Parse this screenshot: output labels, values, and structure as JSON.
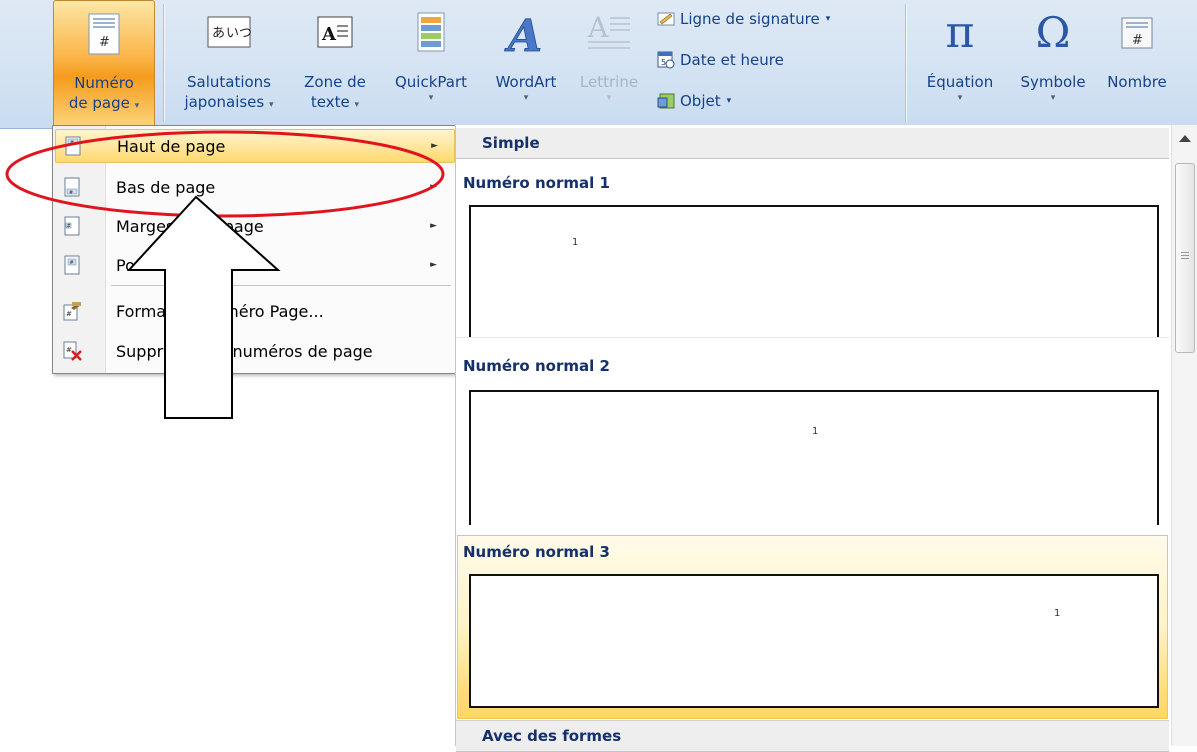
{
  "ribbon": {
    "page_number": {
      "line1": "Numéro",
      "line2": "de page",
      "caret": "▾",
      "icon": "page-number-icon"
    },
    "greetings": {
      "line1": "Salutations",
      "line2": "japonaises",
      "caret": "▾",
      "icon": "japanese-greetings-icon"
    },
    "textbox": {
      "line1": "Zone de",
      "line2": "texte",
      "caret": "▾",
      "icon": "text-box-icon"
    },
    "quickpart": {
      "line1": "QuickPart",
      "caret": "▾",
      "icon": "quickpart-icon"
    },
    "wordart": {
      "line1": "WordArt",
      "caret": "▾",
      "icon": "wordart-icon"
    },
    "dropcap": {
      "line1": "Lettrine",
      "caret": "▾",
      "icon": "dropcap-icon"
    },
    "signature_line": {
      "label": "Ligne de signature",
      "caret": "▾",
      "icon": "signature-icon"
    },
    "date_time": {
      "label": "Date et heure",
      "icon": "calendar-icon"
    },
    "object": {
      "label": "Objet",
      "caret": "▾",
      "icon": "object-icon"
    },
    "equation": {
      "line1": "Équation",
      "caret": "▾",
      "icon": "pi-icon",
      "glyph": "π"
    },
    "symbol": {
      "line1": "Symbole",
      "caret": "▾",
      "icon": "omega-icon",
      "glyph": "Ω"
    },
    "number": {
      "line1": "Nombre",
      "icon": "number-icon"
    }
  },
  "menu": {
    "items": [
      {
        "label": "Haut de page",
        "has_submenu": true,
        "highlighted": true
      },
      {
        "label": "Bas de page",
        "has_submenu": true
      },
      {
        "label": "Marges de la page",
        "has_submenu": true
      },
      {
        "label": "Position actuelle",
        "has_submenu": true
      },
      {
        "label": "Format du numéro Page...",
        "has_submenu": false
      },
      {
        "label": "Supprimer les numéros de page",
        "has_submenu": false
      }
    ],
    "submenu_arrow": "►"
  },
  "gallery": {
    "category1": "Simple",
    "item1_title": "Numéro normal 1",
    "item2_title": "Numéro normal 2",
    "item3_title": "Numéro normal 3",
    "category2": "Avec des formes",
    "page_num": "1"
  },
  "colors": {
    "ribbon_bg": "#d4e3f3",
    "active_orange": "#fbb447",
    "menu_highlight": "#ffe7a0",
    "annotation_red": "#e0141e"
  }
}
